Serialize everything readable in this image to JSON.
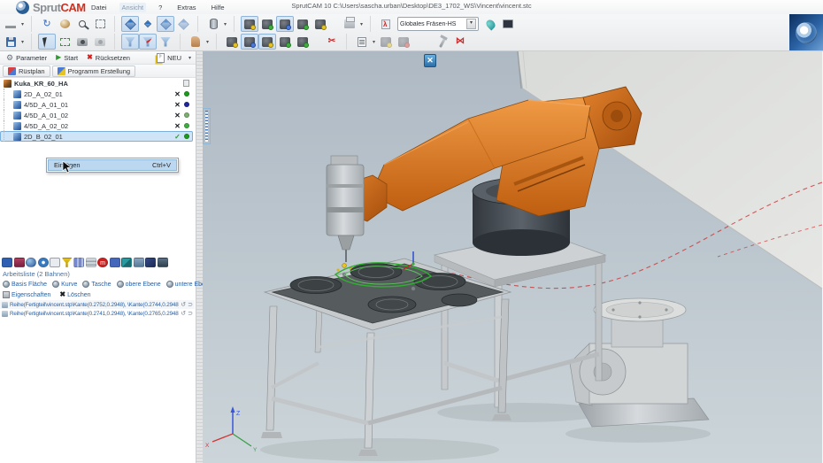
{
  "window": {
    "title": "SprutCAM 10   C:\\Users\\sascha.urban\\Desktop\\DE3_1702_WS\\Vincent\\vincent.stc"
  },
  "brand": {
    "sprut": "Sprut",
    "cam": "CAM"
  },
  "menu": {
    "items": [
      "Datei",
      "Ansicht",
      "?",
      "Extras",
      "Hilfe"
    ]
  },
  "toolbar": {
    "scheme_combo": "Globales Fräsen-HS"
  },
  "ops": {
    "parameter": "Parameter",
    "start": "Start",
    "reset": "Rücksetzen",
    "neu": "NEU",
    "ruestplan": "Rüstplan",
    "programm": "Programm Erstellung"
  },
  "tree": {
    "root": "Kuka_KR_60_HA",
    "items": [
      {
        "label": "2D_A_02_01",
        "status": "✕",
        "dot": "#1d9b1d"
      },
      {
        "label": "4/5D_A_01_01",
        "status": "✕",
        "dot": "#20269b"
      },
      {
        "label": "4/5D_A_01_02",
        "status": "✕",
        "dot": "#7cb06e"
      },
      {
        "label": "4/5D_A_02_02",
        "status": "✕",
        "dot": "#3fae3f"
      },
      {
        "label": "2D_B_02_01",
        "status": "✓",
        "dot": "#1d9b1d"
      }
    ]
  },
  "context_menu": {
    "label": "Einfügen",
    "shortcut": "Ctrl+V"
  },
  "worklist": {
    "title": "Arbeitsliste (2 Bahnen)",
    "shapes": [
      "Basis Fläche",
      "Kurve",
      "Tasche",
      "obere Ebene",
      "untere Ebene"
    ],
    "actions": [
      "Eigenschaften",
      "Löschen"
    ],
    "rows": [
      "Reihe(Fertigteil\\vincent.stp\\Kante(0.2752,0.2948), \\Kante(0.2744,0.2948))",
      "Reihe(Fertigteil\\vincent.stp\\Kante(0.2741,0.2948), \\Kante(0.2765,0.2948))"
    ]
  },
  "viewport": {
    "axes": {
      "x": "X",
      "y": "Y",
      "z": "Z"
    }
  },
  "colors": {
    "robot_orange": "#d9731f",
    "selection_blue": "#bcd8f0",
    "viewport_top": "#aeb9c4",
    "viewport_bottom": "#ccd5d9",
    "link_blue": "#2b5fa0"
  }
}
